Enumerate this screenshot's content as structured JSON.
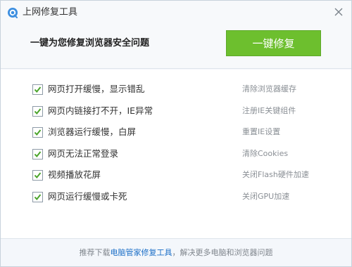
{
  "window": {
    "title": "上网修复工具",
    "logo_icon": "qq-guard-logo-icon",
    "close_icon": "close-icon"
  },
  "header": {
    "description": "一键为您修复浏览器安全问题",
    "fix_button_label": "一键修复"
  },
  "items": [
    {
      "label": "网页打开缓慢，显示错乱",
      "action": "清除浏览器缓存",
      "checked": true
    },
    {
      "label": "网页内链接打不开，IE异常",
      "action": "注册IE关键组件",
      "checked": true
    },
    {
      "label": "浏览器运行缓慢，白屏",
      "action": "重置IE设置",
      "checked": true
    },
    {
      "label": "网页无法正常登录",
      "action": "清除Cookies",
      "checked": true
    },
    {
      "label": "视频播放花屏",
      "action": "关闭Flash硬件加速",
      "checked": true
    },
    {
      "label": "网页运行缓慢或卡死",
      "action": "关闭GPU加速",
      "checked": true
    }
  ],
  "footer": {
    "prefix": "推荐下载",
    "link": "电脑管家修复工具",
    "suffix": "，解决更多电脑和浏览器问题"
  },
  "colors": {
    "accent_green": "#6dbf2e",
    "check_green": "#4aa42a",
    "link_blue": "#1b6fc7"
  }
}
